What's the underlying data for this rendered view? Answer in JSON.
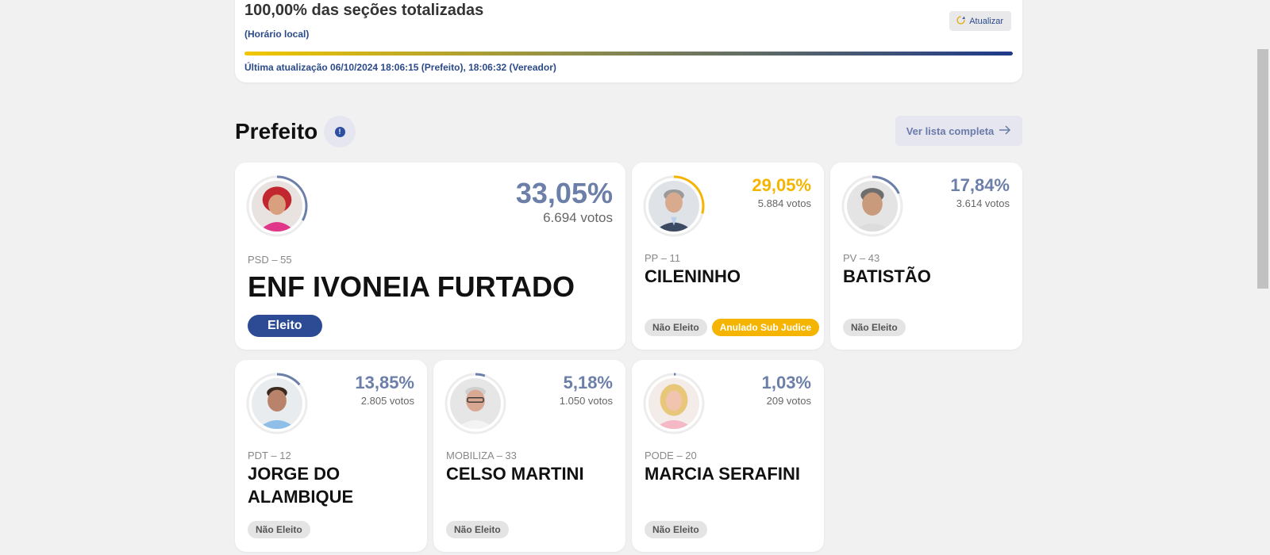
{
  "status": {
    "title": "100,00% das seções totalizadas",
    "local_time": "(Horário local)",
    "refresh_label": "Atualizar",
    "progress": 1.0,
    "last_update": "Última atualização 06/10/2024 18:06:15 (Prefeito), 18:06:32 (Vereador)"
  },
  "section": {
    "title": "Prefeito",
    "info_icon": "info-icon",
    "list_button": "Ver lista completa"
  },
  "colors": {
    "primary_blue": "#2d4b95",
    "percent_blue": "#6b7fa8",
    "sub_judice_yellow": "#f5b400",
    "badge_gray": "#e4e4e4"
  },
  "candidates": [
    {
      "percent": "33,05%",
      "votes": "6.694 votos",
      "party": "PSD – 55",
      "name": "ENF IVONEIA FURTADO",
      "badges": [
        "Eleito"
      ],
      "ring_color": "#6b7fa8",
      "share": 0.3305
    },
    {
      "percent": "29,05%",
      "votes": "5.884 votos",
      "party": "PP – 11",
      "name": "CILENINHO",
      "badges": [
        "Não Eleito",
        "Anulado Sub Judice"
      ],
      "ring_color": "#f5b400",
      "share": 0.2905
    },
    {
      "percent": "17,84%",
      "votes": "3.614 votos",
      "party": "PV – 43",
      "name": "BATISTÃO",
      "badges": [
        "Não Eleito"
      ],
      "ring_color": "#6b7fa8",
      "share": 0.1784
    },
    {
      "percent": "13,85%",
      "votes": "2.805 votos",
      "party": "PDT – 12",
      "name": "JORGE DO ALAMBIQUE",
      "badges": [
        "Não Eleito"
      ],
      "ring_color": "#6b7fa8",
      "share": 0.1385
    },
    {
      "percent": "5,18%",
      "votes": "1.050 votos",
      "party": "MOBILIZA – 33",
      "name": "CELSO MARTINI",
      "badges": [
        "Não Eleito"
      ],
      "ring_color": "#6b7fa8",
      "share": 0.0518
    },
    {
      "percent": "1,03%",
      "votes": "209 votos",
      "party": "PODE – 20",
      "name": "MARCIA SERAFINI",
      "badges": [
        "Não Eleito"
      ],
      "ring_color": "#6b7fa8",
      "share": 0.0103
    }
  ]
}
